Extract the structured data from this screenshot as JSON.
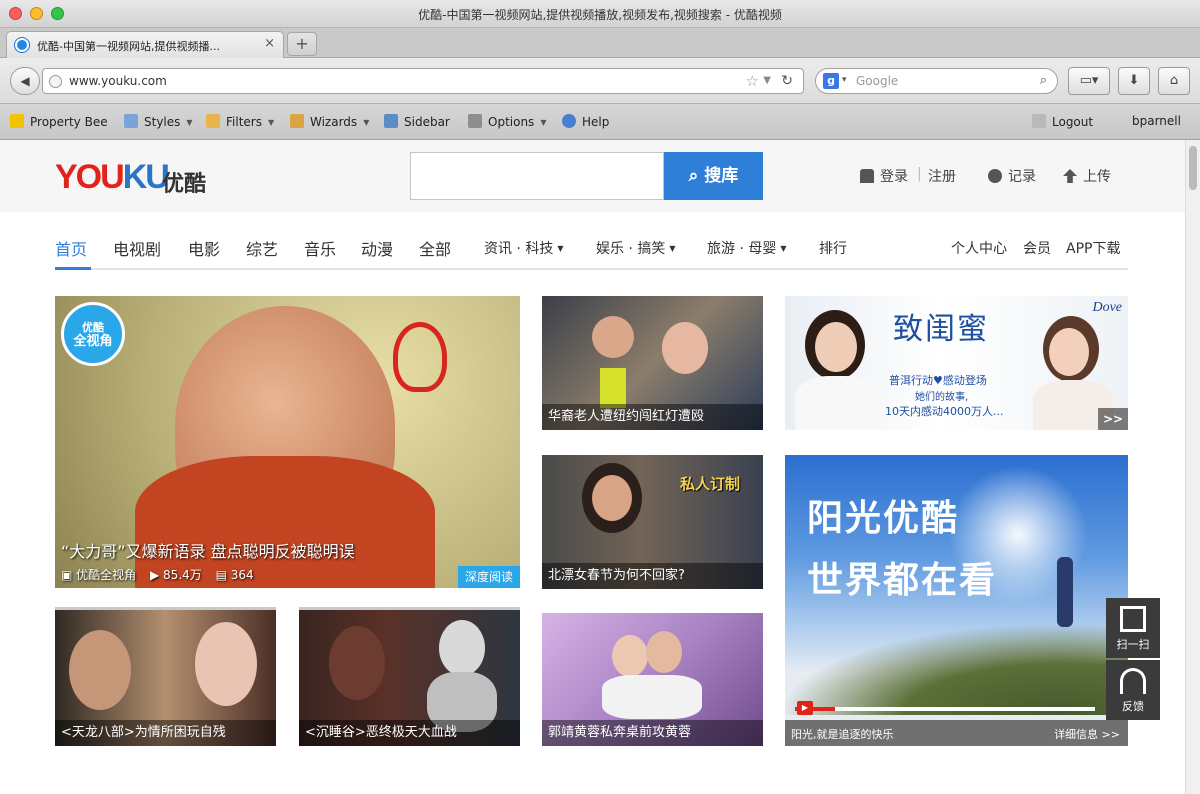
{
  "window": {
    "title": "优酷-中国第一视频网站,提供视频播放,视频发布,视频搜索 - 优酷视频"
  },
  "tab": {
    "label": "优酷-中国第一视频网站,提供视频播...",
    "close": "×",
    "new": "+"
  },
  "nav": {
    "url": "www.youku.com",
    "back": "◀",
    "search_engine_icon": "google-g-icon",
    "search_placeholder": "Google",
    "colors": {
      "accent": "#2f7fd9"
    }
  },
  "bookmarks": [
    {
      "label": "Property Bee",
      "icon": "bee-icon"
    },
    {
      "label": "Styles",
      "icon": "styles-icon",
      "menu": true
    },
    {
      "label": "Filters",
      "icon": "filters-icon",
      "menu": true
    },
    {
      "label": "Wizards",
      "icon": "wand-icon",
      "menu": true
    },
    {
      "label": "Sidebar",
      "icon": "sidebar-icon"
    },
    {
      "label": "Options",
      "icon": "options-icon",
      "menu": true
    },
    {
      "label": "Help",
      "icon": "help-icon"
    }
  ],
  "bookmarks_right": {
    "logout": "Logout",
    "user": "bparnell"
  },
  "header": {
    "logo_you": "YOU",
    "logo_ku": "KU",
    "logo_cn": "优酷",
    "search_button": "搜库",
    "login": "登录",
    "register": "注册",
    "history": "记录",
    "upload": "上传"
  },
  "categories": {
    "main": [
      "首页",
      "电视剧",
      "电影",
      "综艺",
      "音乐",
      "动漫",
      "全部"
    ],
    "dropdowns": [
      "资讯 · 科技",
      "娱乐 · 搞笑",
      "旅游 · 母婴"
    ],
    "rank": "排行",
    "right": [
      "个人中心",
      "会员",
      "APP下载"
    ]
  },
  "feature": {
    "badge_top": "优酷",
    "badge_bottom": "全视角",
    "title": "“大力哥”又爆新语录 盘点聪明反被聪明误",
    "source": "优酷全视角",
    "plays": "85.4万",
    "comments": "364",
    "tag": "深度阅读"
  },
  "tiles": {
    "t1": "华裔老人遭纽约闯红灯遭殴",
    "t2": "北漂女春节为何不回家?",
    "t2_tag": "私人订制",
    "t3": "<天龙八部>为情所困玩自残",
    "t4": "<沉睡谷>恶终极天大血战",
    "t5": "郭靖黄蓉私奔桌前攻黄蓉"
  },
  "ad": {
    "brand": "Dove",
    "headline": "致闺蜜",
    "sub": "普洱行动♥感动登场",
    "sub2": "她们的故事,",
    "sub3": "10天内感动4000万人...",
    "more": ">>"
  },
  "promo": {
    "line1": "阳光优酷",
    "line2": "世界都在看",
    "footer_left": "阳光,就是追逐的快乐",
    "footer_right": "详细信息 >>",
    "qr_label": "扫一扫",
    "feedback_label": "反馈"
  }
}
